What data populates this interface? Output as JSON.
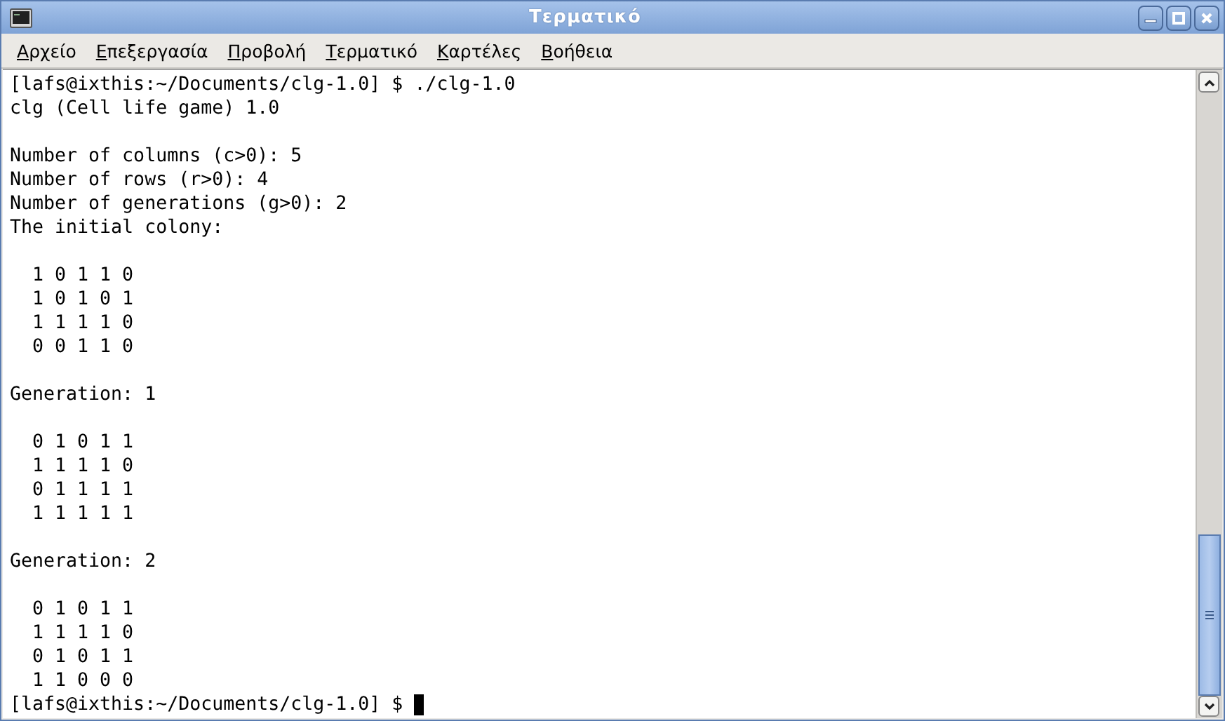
{
  "window": {
    "title": "Τερματικό"
  },
  "menu": [
    "Αρχείο",
    "Επεξεργασία",
    "Προβολή",
    "Τερματικό",
    "Καρτέλες",
    "Βοήθεια"
  ],
  "terminal": {
    "blocks": [
      [
        "[lafs@ixthis:~/Documents/clg-1.0] $ ./clg-1.0",
        "clg (Cell life game) 1.0"
      ],
      [
        "Number of columns (c>0): 5",
        "Number of rows (r>0): 4",
        "Number of generations (g>0): 2",
        "The initial colony:"
      ],
      [
        "  1 0 1 1 0",
        "  1 0 1 0 1",
        "  1 1 1 1 0",
        "  0 0 1 1 0"
      ],
      [
        "Generation: 1"
      ],
      [
        "  0 1 0 1 1",
        "  1 1 1 1 0",
        "  0 1 1 1 1",
        "  1 1 1 1 1"
      ],
      [
        "Generation: 2"
      ],
      [
        "  0 1 0 1 1",
        "  1 1 1 1 0",
        "  0 1 0 1 1",
        "  1 1 0 0 0"
      ]
    ],
    "prompt": "[lafs@ixthis:~/Documents/clg-1.0] $"
  }
}
